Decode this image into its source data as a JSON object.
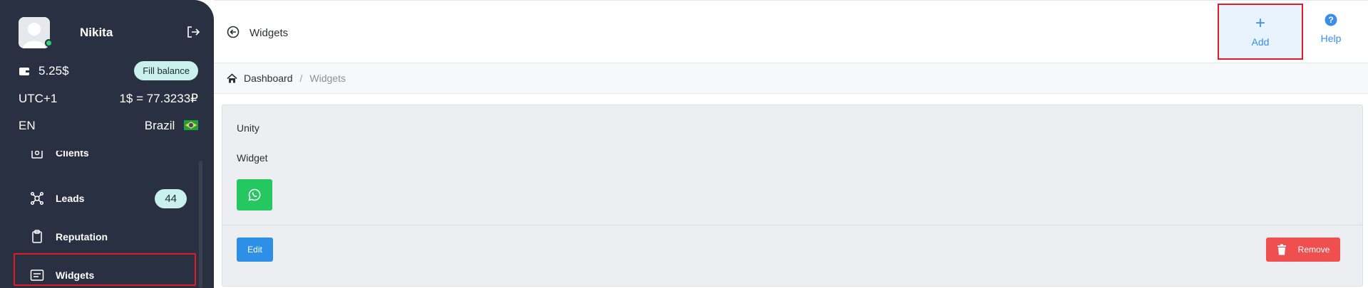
{
  "user": {
    "name": "Nikita"
  },
  "balance": {
    "amount": "5.25$",
    "fill_label": "Fill balance"
  },
  "settings": {
    "timezone": "UTC+1",
    "rate": "1$ = 77.3233₽",
    "language": "EN",
    "country": "Brazil"
  },
  "sidebar": {
    "items": [
      {
        "label": "Clients",
        "icon": "clients-icon"
      },
      {
        "label": "Leads",
        "icon": "leads-icon",
        "badge": "44"
      },
      {
        "label": "Reputation",
        "icon": "clipboard-icon"
      },
      {
        "label": "Widgets",
        "icon": "widgets-icon",
        "active": true
      }
    ]
  },
  "header": {
    "title": "Widgets",
    "add_label": "Add",
    "help_label": "Help"
  },
  "breadcrumb": {
    "home": "Dashboard",
    "separator": "/",
    "current": "Widgets"
  },
  "widget": {
    "name": "Unity",
    "type": "Widget",
    "channel_icon": "whatsapp-icon",
    "edit_label": "Edit",
    "remove_label": "Remove"
  },
  "colors": {
    "sidebar": "#283042",
    "accent": "#2d8fe6",
    "danger": "#ef4f4f",
    "whatsapp": "#25c760",
    "badge": "#c9f0ea",
    "highlight": "#e31b23"
  }
}
